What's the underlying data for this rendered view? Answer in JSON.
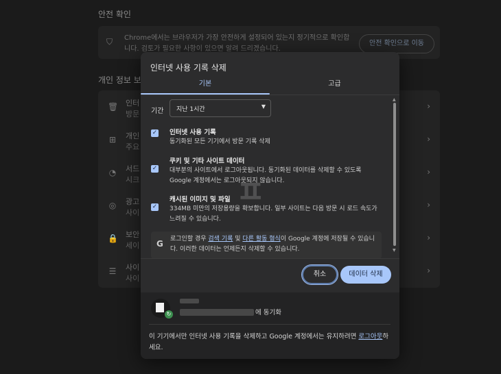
{
  "background": {
    "safety_title": "안전 확인",
    "safety_text": "Chrome에서는 브라우저가 가장 안전하게 설정되어 있는지 정기적으로 확인합니다. 검토가 필요한 사항이 있으면 알려 드리겠습니다.",
    "safety_button": "안전 확인으로 이동",
    "privacy_title": "개인 정보 보호",
    "rows": [
      {
        "l1": "인터",
        "l2": "방문"
      },
      {
        "l1": "개인",
        "l2": "주요"
      },
      {
        "l1": "서드",
        "l2": "시크"
      },
      {
        "l1": "광고",
        "l2": "사이"
      },
      {
        "l1": "보안",
        "l2": "세이"
      },
      {
        "l1": "사이",
        "l2": "사이"
      }
    ]
  },
  "dialog": {
    "title": "인터넷 사용 기록 삭제",
    "tabs": {
      "basic": "기본",
      "advanced": "고급"
    },
    "time_range_label": "기간",
    "time_range_value": "지난 1시간",
    "options": [
      {
        "title": "인터넷 사용 기록",
        "desc": "동기화된 모든 기기에서 방문 기록 삭제",
        "checked": true
      },
      {
        "title": "쿠키 및 기타 사이트 데이터",
        "desc": "대부분의 사이트에서 로그아웃됩니다. 동기화된 데이터를 삭제할 수 있도록 Google 계정에서는 로그아웃되지 않습니다.",
        "checked": true
      },
      {
        "title": "캐시된 이미지 및 파일",
        "desc": "334MB 미만의 저장용량을 확보합니다. 일부 사이트는 다음 방문 시 로드 속도가 느려질 수 있습니다.",
        "checked": true
      }
    ],
    "note": {
      "pre": "로그인할 경우 ",
      "link1": "검색 기록",
      "mid": " 및 ",
      "link2": "다른 활동 형식",
      "post": "이 Google 계정에 저장될 수 있습니다. 이러한 데이터는 언제든지 삭제할 수 있습니다."
    },
    "cancel": "취소",
    "delete": "데이터 삭제",
    "sync_label": "에 동기화",
    "footer": {
      "text": "이 기기에서만 인터넷 사용 기록을 삭제하고 Google 계정에서는 유지하려면 ",
      "link": "로그아웃",
      "end": "하세요."
    }
  },
  "colors": {
    "accent": "#a8c7fa",
    "dialog_bg": "#2c2c2d",
    "page_bg": "#1b1b1b"
  }
}
